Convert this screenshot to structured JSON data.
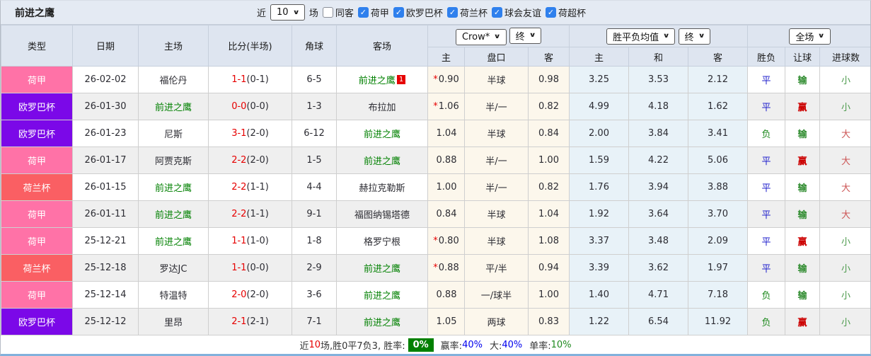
{
  "header_bar": {
    "title": "前进之鹰",
    "near_label": "近",
    "recent_count": "10",
    "matches_label": "场",
    "checkboxes": [
      {
        "label": "同客",
        "checked": false
      },
      {
        "label": "荷甲",
        "checked": true
      },
      {
        "label": "欧罗巴杯",
        "checked": true
      },
      {
        "label": "荷兰杯",
        "checked": true
      },
      {
        "label": "球会友谊",
        "checked": true
      },
      {
        "label": "荷超杯",
        "checked": true
      }
    ]
  },
  "table": {
    "columns": [
      "类型",
      "日期",
      "主场",
      "比分(半场)",
      "角球",
      "客场"
    ],
    "selects": {
      "bookmaker": "Crow*",
      "handicap_time": "终",
      "odds_type": "胜平负均值",
      "odds_time": "终",
      "scope": "全场"
    },
    "sub_columns": [
      "主",
      "盘口",
      "客",
      "主",
      "和",
      "客",
      "胜负",
      "让球",
      "进球数"
    ],
    "rows": [
      {
        "league": "荷甲",
        "league_color": "#ff72a7",
        "date": "26-02-02",
        "home": "福伦丹",
        "home_self": false,
        "score": "1-1",
        "half": "(0-1)",
        "corners": "6-5",
        "away": "前进之鹰",
        "away_self": true,
        "away_mark": "1",
        "ah_star": "*",
        "ah_home": "0.90",
        "ah_line": "半球",
        "ah_away": "0.98",
        "avg_home": "3.25",
        "avg_draw": "3.53",
        "avg_away": "2.12",
        "res_wdl": "平",
        "res_ah": "输",
        "res_goal": "小"
      },
      {
        "league": "欧罗巴杯",
        "league_color": "#7b08e8",
        "date": "26-01-30",
        "home": "前进之鹰",
        "home_self": true,
        "score": "0-0",
        "half": "(0-0)",
        "corners": "1-3",
        "away": "布拉加",
        "away_self": false,
        "away_mark": "",
        "ah_star": "*",
        "ah_home": "1.06",
        "ah_line": "半/一",
        "ah_away": "0.82",
        "avg_home": "4.99",
        "avg_draw": "4.18",
        "avg_away": "1.62",
        "res_wdl": "平",
        "res_ah": "赢",
        "res_goal": "小"
      },
      {
        "league": "欧罗巴杯",
        "league_color": "#7b08e8",
        "date": "26-01-23",
        "home": "尼斯",
        "home_self": false,
        "score": "3-1",
        "half": "(2-0)",
        "corners": "6-12",
        "away": "前进之鹰",
        "away_self": true,
        "away_mark": "",
        "ah_star": "",
        "ah_home": "1.04",
        "ah_line": "半球",
        "ah_away": "0.84",
        "avg_home": "2.00",
        "avg_draw": "3.84",
        "avg_away": "3.41",
        "res_wdl": "负",
        "res_ah": "输",
        "res_goal": "大"
      },
      {
        "league": "荷甲",
        "league_color": "#ff72a7",
        "date": "26-01-17",
        "home": "阿贾克斯",
        "home_self": false,
        "score": "2-2",
        "half": "(2-0)",
        "corners": "1-5",
        "away": "前进之鹰",
        "away_self": true,
        "away_mark": "",
        "ah_star": "",
        "ah_home": "0.88",
        "ah_line": "半/一",
        "ah_away": "1.00",
        "avg_home": "1.59",
        "avg_draw": "4.22",
        "avg_away": "5.06",
        "res_wdl": "平",
        "res_ah": "赢",
        "res_goal": "大"
      },
      {
        "league": "荷兰杯",
        "league_color": "#fa5f63",
        "date": "26-01-15",
        "home": "前进之鹰",
        "home_self": true,
        "score": "2-2",
        "half": "(1-1)",
        "corners": "4-4",
        "away": "赫拉克勒斯",
        "away_self": false,
        "away_mark": "",
        "ah_star": "",
        "ah_home": "1.00",
        "ah_line": "半/一",
        "ah_away": "0.82",
        "avg_home": "1.76",
        "avg_draw": "3.94",
        "avg_away": "3.88",
        "res_wdl": "平",
        "res_ah": "输",
        "res_goal": "大"
      },
      {
        "league": "荷甲",
        "league_color": "#ff72a7",
        "date": "26-01-11",
        "home": "前进之鹰",
        "home_self": true,
        "score": "2-2",
        "half": "(1-1)",
        "corners": "9-1",
        "away": "福图纳锡塔德",
        "away_self": false,
        "away_mark": "",
        "ah_star": "",
        "ah_home": "0.84",
        "ah_line": "半球",
        "ah_away": "1.04",
        "avg_home": "1.92",
        "avg_draw": "3.64",
        "avg_away": "3.70",
        "res_wdl": "平",
        "res_ah": "输",
        "res_goal": "大"
      },
      {
        "league": "荷甲",
        "league_color": "#ff72a7",
        "date": "25-12-21",
        "home": "前进之鹰",
        "home_self": true,
        "score": "1-1",
        "half": "(1-0)",
        "corners": "1-8",
        "away": "格罗宁根",
        "away_self": false,
        "away_mark": "",
        "ah_star": "*",
        "ah_home": "0.80",
        "ah_line": "半球",
        "ah_away": "1.08",
        "avg_home": "3.37",
        "avg_draw": "3.48",
        "avg_away": "2.09",
        "res_wdl": "平",
        "res_ah": "赢",
        "res_goal": "小"
      },
      {
        "league": "荷兰杯",
        "league_color": "#fa5f63",
        "date": "25-12-18",
        "home": "罗达JC",
        "home_self": false,
        "score": "1-1",
        "half": "(0-0)",
        "corners": "2-9",
        "away": "前进之鹰",
        "away_self": true,
        "away_mark": "",
        "ah_star": "*",
        "ah_home": "0.88",
        "ah_line": "平/半",
        "ah_away": "0.94",
        "avg_home": "3.39",
        "avg_draw": "3.62",
        "avg_away": "1.97",
        "res_wdl": "平",
        "res_ah": "输",
        "res_goal": "小"
      },
      {
        "league": "荷甲",
        "league_color": "#ff72a7",
        "date": "25-12-14",
        "home": "特温特",
        "home_self": false,
        "score": "2-0",
        "half": "(2-0)",
        "corners": "3-6",
        "away": "前进之鹰",
        "away_self": true,
        "away_mark": "",
        "ah_star": "",
        "ah_home": "0.88",
        "ah_line": "一/球半",
        "ah_away": "1.00",
        "avg_home": "1.40",
        "avg_draw": "4.71",
        "avg_away": "7.18",
        "res_wdl": "负",
        "res_ah": "输",
        "res_goal": "小"
      },
      {
        "league": "欧罗巴杯",
        "league_color": "#7b08e8",
        "date": "25-12-12",
        "home": "里昂",
        "home_self": false,
        "score": "2-1",
        "half": "(2-1)",
        "corners": "7-1",
        "away": "前进之鹰",
        "away_self": true,
        "away_mark": "",
        "ah_star": "",
        "ah_home": "1.05",
        "ah_line": "两球",
        "ah_away": "0.83",
        "avg_home": "1.22",
        "avg_draw": "6.54",
        "avg_away": "11.92",
        "res_wdl": "负",
        "res_ah": "赢",
        "res_goal": "小"
      }
    ]
  },
  "summary": {
    "segments": [
      {
        "text": "近",
        "color": "#333333"
      },
      {
        "text": "10",
        "color": "#e60000"
      },
      {
        "text": "场,胜0平7负3, 胜率:",
        "color": "#333333"
      },
      {
        "text": "0%",
        "color": "#ffffff",
        "bg": "#008000",
        "box": true
      },
      {
        "text": "赢率:",
        "color": "#333333",
        "gap": true
      },
      {
        "text": "40%",
        "color": "#0000ee"
      },
      {
        "text": "大:",
        "color": "#333333",
        "gap": true
      },
      {
        "text": "40%",
        "color": "#0000ee"
      },
      {
        "text": "单率:",
        "color": "#333333",
        "gap": true
      },
      {
        "text": "10%",
        "color": "#1f8a1f"
      }
    ]
  },
  "colors": {
    "self_team": "#008000",
    "score_red": "#e60000",
    "star_red": "#e60000",
    "away_badge_bg": "#e60000",
    "handicap_col_bg": "#fcf7ec",
    "avg_col_bg": "#e8f2f8",
    "checkbox_blue": "#2f80ed",
    "result_text": {
      "平": "#2222cc",
      "负": "#1f8a1f",
      "胜": "#cc0000",
      "赢": "#cc0000",
      "输": "#2e8b2e",
      "大": "#cc5555",
      "小": "#4c9a4c"
    }
  }
}
